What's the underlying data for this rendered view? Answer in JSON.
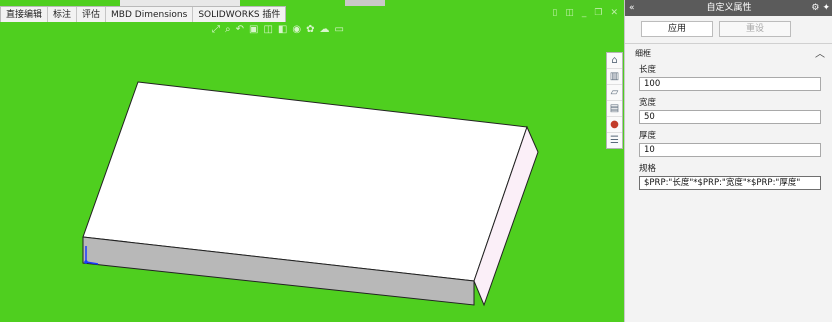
{
  "tabs": [
    "直接编辑",
    "标注",
    "评估",
    "MBD Dimensions",
    "SOLIDWORKS 插件"
  ],
  "panel": {
    "title": "自定义属性",
    "collapse_icon": "double-chevron-left",
    "apply_label": "应用",
    "reset_label": "重设",
    "group_label": "细框",
    "fields": [
      {
        "label": "长度",
        "value": "100"
      },
      {
        "label": "宽度",
        "value": "50"
      },
      {
        "label": "厚度",
        "value": "10"
      },
      {
        "label": "规格",
        "value": "$PRP:\"长度\"*$PRP:\"宽度\"*$PRP:\"厚度\""
      }
    ]
  },
  "colors": {
    "viewport_bg": "#4fcf1f",
    "panel_header": "#5b5b5b",
    "part_top": "#ffffff",
    "part_front": "#b8b8b8",
    "part_side": "#fbeff8"
  },
  "icons": [
    "home-icon",
    "3d-views-icon",
    "file-explorer-icon",
    "view-palette-icon",
    "appearances-icon",
    "custom-properties-icon"
  ]
}
